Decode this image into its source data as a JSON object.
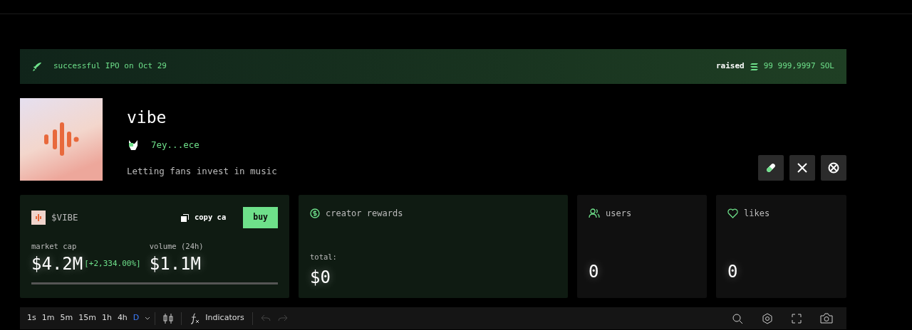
{
  "banner": {
    "status": "successful IPO on Oct 29",
    "raised_label": "raised",
    "raised_value": "99 999,9997 SOL"
  },
  "coin": {
    "name": "vibe",
    "creator": "7ey...ece",
    "description": "Letting fans invest in music"
  },
  "market_card": {
    "ticker": "$VIBE",
    "copy_label": "copy ca",
    "buy_label": "buy",
    "market_cap_label": "market cap",
    "market_cap": "$4.2M",
    "change": "[+2,334.00%]",
    "volume_label": "volume (24h)",
    "volume": "$1.1M"
  },
  "rewards_card": {
    "title": "creator rewards",
    "total_label": "total:",
    "total": "$0"
  },
  "stat_cards": [
    {
      "kind": "users",
      "title": "users",
      "value": "0"
    },
    {
      "kind": "likes",
      "title": "likes",
      "value": "0"
    }
  ],
  "chart_toolbar": {
    "intervals": [
      {
        "label": "1s",
        "selected": false
      },
      {
        "label": "1m",
        "selected": false
      },
      {
        "label": "5m",
        "selected": false
      },
      {
        "label": "15m",
        "selected": false
      },
      {
        "label": "1h",
        "selected": false
      },
      {
        "label": "4h",
        "selected": false
      },
      {
        "label": "D",
        "selected": true
      }
    ],
    "indicators_label": "Indicators"
  }
}
